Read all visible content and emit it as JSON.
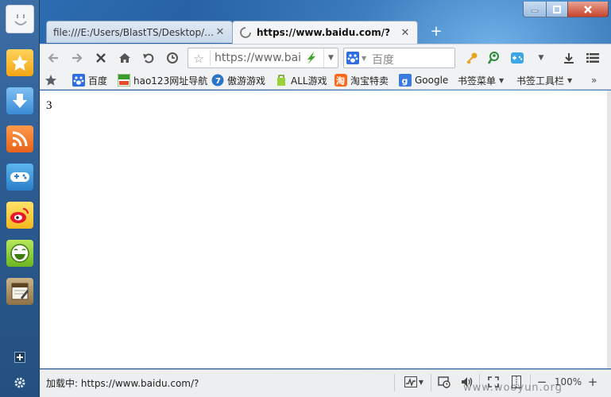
{
  "window": {
    "tabs": [
      {
        "title": "file:///E:/Users/BlastTS/Desktop/%E...",
        "active": false
      },
      {
        "title": "https://www.baidu.com/?",
        "active": true
      }
    ],
    "new_tab_label": "+"
  },
  "navbar": {
    "url": "https://www.bai",
    "search_placeholder": "百度"
  },
  "bookmarks": [
    {
      "label": "百度",
      "icon": "baidu-paw-icon"
    },
    {
      "label": "hao123网址导航",
      "icon": "hao123-icon"
    },
    {
      "label": "傲游游戏",
      "icon": "maxthon-game-icon"
    },
    {
      "label": "ALL游戏",
      "icon": "all-game-icon"
    },
    {
      "label": "淘宝特卖",
      "icon": "taobao-icon"
    },
    {
      "label": "Google",
      "icon": "google-icon"
    },
    {
      "label": "书签菜单",
      "icon": "dropdown"
    },
    {
      "label": "书签工具栏",
      "icon": "dropdown"
    }
  ],
  "page": {
    "content_text": "3"
  },
  "status": {
    "loading_text": "加载中: https://www.baidu.com/?",
    "zoom": "100%"
  },
  "watermark": "www.wooyun.org",
  "colors": {
    "sidebar": "#2b5a8f",
    "wallpaper": "#1e5592",
    "toolbar": "#f1f2f3"
  }
}
